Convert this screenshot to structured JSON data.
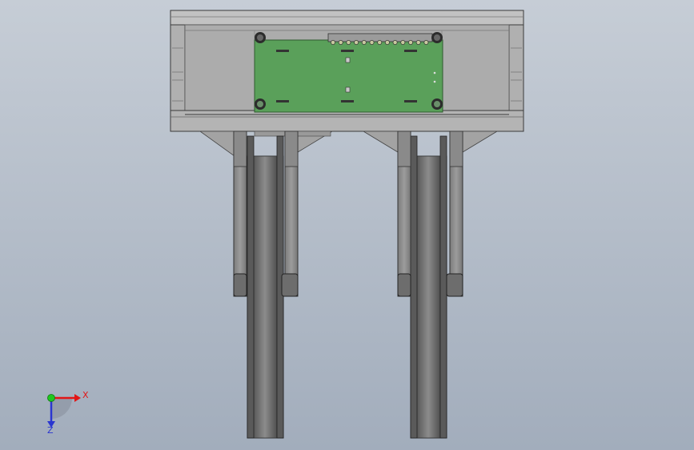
{
  "viewport": {
    "background_top": "#c6cdd6",
    "background_bottom": "#a2adbc"
  },
  "triad": {
    "x_label": "X",
    "z_label": "Z",
    "x_color": "#e21616",
    "y_color": "#1ec81e",
    "z_color": "#2a36d0"
  },
  "model": {
    "frame_color": "#b7b7b7",
    "frame_dark": "#8f8f8f",
    "pcb_color": "#5aa05a",
    "bracket_color": "#8e8e8e",
    "wheel_color": "#6c6c6c",
    "wheel_highlight": "#a0a0a0"
  }
}
